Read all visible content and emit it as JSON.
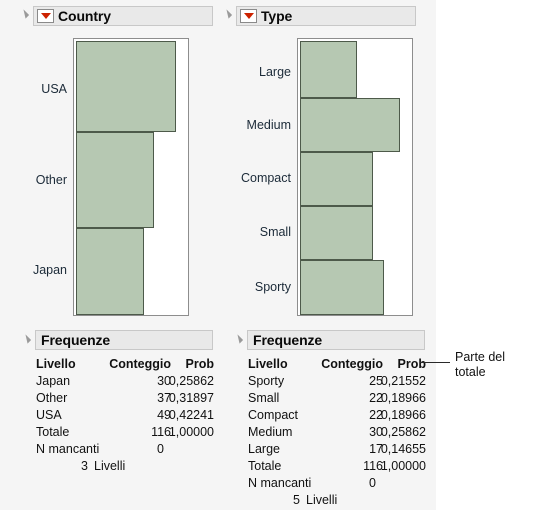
{
  "panel": {
    "background": "#f5f5f5",
    "page_background": "#ffffff"
  },
  "colors": {
    "bar_fill": "#b6c8b2",
    "bar_border": "#4d5a4a",
    "header_bar": "#e9e9e9",
    "header_border": "#c8c8c8",
    "red_triangle": "#cc2200",
    "text": "#111111"
  },
  "panels": [
    {
      "id": "country",
      "header": {
        "title": "Country",
        "disclosure_icon": "disclosure-triangle-icon",
        "menu_icon": "red-triangle-menu-icon"
      },
      "chart": {
        "type": "bar",
        "orientation": "horizontal",
        "categories": [
          "USA",
          "Other",
          "Japan"
        ],
        "values": [
          49,
          37,
          30
        ],
        "proportions": [
          0.42241,
          0.31897,
          0.25862
        ],
        "title": "",
        "xlabel": "",
        "ylabel": "",
        "grid": false,
        "legend": "none"
      },
      "freq": {
        "header": {
          "title": "Frequenze",
          "disclosure_icon": "disclosure-triangle-icon"
        },
        "columns": [
          "Livello",
          "Conteggio",
          "Prob"
        ],
        "rows": [
          {
            "level": "Japan",
            "count": "30",
            "prob": "0,25862"
          },
          {
            "level": "Other",
            "count": "37",
            "prob": "0,31897"
          },
          {
            "level": "USA",
            "count": "49",
            "prob": "0,42241"
          },
          {
            "level": "Totale",
            "count": "116",
            "prob": "1,00000"
          }
        ],
        "missing_label": "N mancanti",
        "missing_value": "0",
        "levels_count": "3",
        "levels_label": "Livelli"
      }
    },
    {
      "id": "type",
      "header": {
        "title": "Type",
        "disclosure_icon": "disclosure-triangle-icon",
        "menu_icon": "red-triangle-menu-icon"
      },
      "chart": {
        "type": "bar",
        "orientation": "horizontal",
        "categories": [
          "Large",
          "Medium",
          "Compact",
          "Small",
          "Sporty"
        ],
        "values": [
          17,
          30,
          22,
          22,
          25
        ],
        "proportions": [
          0.14655,
          0.25862,
          0.18966,
          0.18966,
          0.21552
        ],
        "title": "",
        "xlabel": "",
        "ylabel": "",
        "grid": false,
        "legend": "none"
      },
      "freq": {
        "header": {
          "title": "Frequenze",
          "disclosure_icon": "disclosure-triangle-icon"
        },
        "columns": [
          "Livello",
          "Conteggio",
          "Prob"
        ],
        "rows": [
          {
            "level": "Sporty",
            "count": "25",
            "prob": "0,21552"
          },
          {
            "level": "Small",
            "count": "22",
            "prob": "0,18966"
          },
          {
            "level": "Compact",
            "count": "22",
            "prob": "0,18966"
          },
          {
            "level": "Medium",
            "count": "30",
            "prob": "0,25862"
          },
          {
            "level": "Large",
            "count": "17",
            "prob": "0,14655"
          },
          {
            "level": "Totale",
            "count": "116",
            "prob": "1,00000"
          }
        ],
        "missing_label": "N mancanti",
        "missing_value": "0",
        "levels_count": "5",
        "levels_label": "Livelli"
      }
    }
  ],
  "annotation": {
    "line1": "Parte del",
    "line2": "totale"
  },
  "chart_data": [
    {
      "type": "bar",
      "title": "Country",
      "categories": [
        "USA",
        "Other",
        "Japan"
      ],
      "values": [
        49,
        37,
        30
      ],
      "series": [
        {
          "name": "Conteggio",
          "values": [
            49,
            37,
            30
          ]
        },
        {
          "name": "Prob",
          "values": [
            0.42241,
            0.31897,
            0.25862
          ]
        }
      ],
      "xlabel": "Prob",
      "ylabel": "Country",
      "xlim": [
        0,
        1
      ],
      "grid": false,
      "legend": "none",
      "total": 116
    },
    {
      "type": "bar",
      "title": "Type",
      "categories": [
        "Large",
        "Medium",
        "Compact",
        "Small",
        "Sporty"
      ],
      "values": [
        17,
        30,
        22,
        22,
        25
      ],
      "series": [
        {
          "name": "Conteggio",
          "values": [
            17,
            30,
            22,
            22,
            25
          ]
        },
        {
          "name": "Prob",
          "values": [
            0.14655,
            0.25862,
            0.18966,
            0.18966,
            0.21552
          ]
        }
      ],
      "xlabel": "Prob",
      "ylabel": "Type",
      "xlim": [
        0,
        1
      ],
      "grid": false,
      "legend": "none",
      "total": 116
    }
  ]
}
